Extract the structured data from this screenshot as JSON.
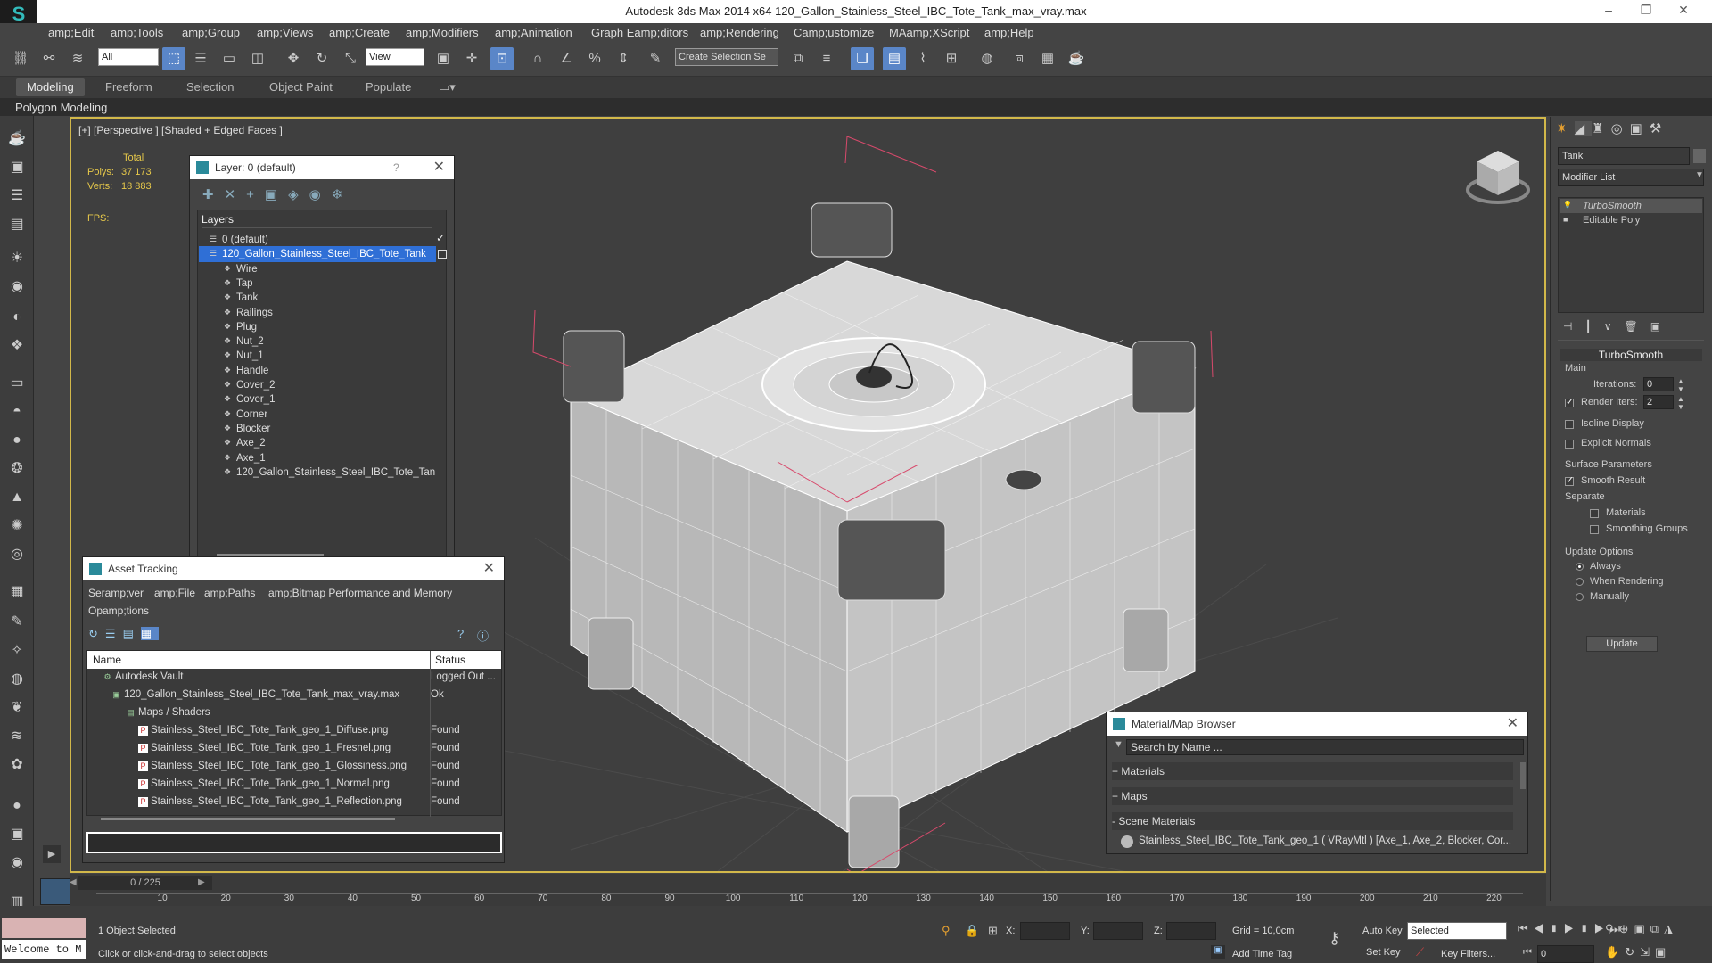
{
  "app": {
    "title": "Autodesk 3ds Max  2014 x64     120_Gallon_Stainless_Steel_IBC_Tote_Tank_max_vray.max"
  },
  "menu": [
    "amp;Edit",
    "amp;Tools",
    "amp;Group",
    "amp;Views",
    "amp;Create",
    "amp;Modifiers",
    "amp;Animation",
    "Graph Eamp;ditors",
    "amp;Rendering",
    "Camp;ustomize",
    "MAamp;XScript",
    "amp;Help"
  ],
  "toolbar": {
    "filter": "All",
    "coord": "View",
    "selset": "Create Selection Se"
  },
  "ribbon": {
    "tabs": [
      "Modeling",
      "Freeform",
      "Selection",
      "Object Paint",
      "Populate"
    ],
    "sub": "Polygon Modeling"
  },
  "viewport": {
    "label": "[+] [Perspective ] [Shaded + Edged Faces ]",
    "stats": {
      "total": "Total",
      "polys_label": "Polys:",
      "polys": "37 173",
      "verts_label": "Verts:",
      "verts": "18 883",
      "fps": "FPS:"
    }
  },
  "layer_win": {
    "title": "Layer: 0 (default)",
    "help": "?",
    "col": "Layers",
    "items": [
      "0 (default)",
      "120_Gallon_Stainless_Steel_IBC_Tote_Tank",
      "Wire",
      "Tap",
      "Tank",
      "Railings",
      "Plug",
      "Nut_2",
      "Nut_1",
      "Handle",
      "Cover_2",
      "Cover_1",
      "Corner",
      "Blocker",
      "Axe_2",
      "Axe_1",
      "120_Gallon_Stainless_Steel_IBC_Tote_Tan"
    ]
  },
  "asset_win": {
    "title": "Asset Tracking",
    "menu": [
      "Seramp;ver",
      "amp;File",
      "amp;Paths",
      "amp;Bitmap Performance and Memory"
    ],
    "menu2": "Opamp;tions",
    "cols": [
      "Name",
      "Status"
    ],
    "rows": [
      {
        "name": "Autodesk Vault",
        "status": "Logged Out ..."
      },
      {
        "name": "120_Gallon_Stainless_Steel_IBC_Tote_Tank_max_vray.max",
        "status": "Ok"
      },
      {
        "name": "Maps / Shaders",
        "status": ""
      },
      {
        "name": "Stainless_Steel_IBC_Tote_Tank_geo_1_Diffuse.png",
        "status": "Found"
      },
      {
        "name": "Stainless_Steel_IBC_Tote_Tank_geo_1_Fresnel.png",
        "status": "Found"
      },
      {
        "name": "Stainless_Steel_IBC_Tote_Tank_geo_1_Glossiness.png",
        "status": "Found"
      },
      {
        "name": "Stainless_Steel_IBC_Tote_Tank_geo_1_Normal.png",
        "status": "Found"
      },
      {
        "name": "Stainless_Steel_IBC_Tote_Tank_geo_1_Reflection.png",
        "status": "Found"
      }
    ]
  },
  "mat_win": {
    "title": "Material/Map Browser",
    "search": "Search by Name ...",
    "sections": [
      "+ Materials",
      "+ Maps",
      "- Scene Materials"
    ],
    "item": "Stainless_Steel_IBC_Tote_Tank_geo_1 ( VRayMtl ) [Axe_1, Axe_2, Blocker, Cor..."
  },
  "panel": {
    "name": "Tank",
    "modlist": "Modifier List",
    "stack": [
      "TurboSmooth",
      "Editable Poly"
    ],
    "rollout": "TurboSmooth",
    "main": "Main",
    "iter_label": "Iterations:",
    "iter": "0",
    "render_label": "Render Iters:",
    "render": "2",
    "isoline": "Isoline Display",
    "explicit": "Explicit Normals",
    "surface": "Surface Parameters",
    "smooth": "Smooth Result",
    "separate": "Separate",
    "materials": "Materials",
    "smoothing": "Smoothing Groups",
    "update_opts": "Update Options",
    "always": "Always",
    "when_rendering": "When Rendering",
    "manually": "Manually",
    "update": "Update"
  },
  "timeline": {
    "frame": "0 / 225",
    "ticks": [
      "10",
      "20",
      "30",
      "40",
      "50",
      "60",
      "70",
      "80",
      "90",
      "100",
      "110",
      "120",
      "130",
      "140",
      "150",
      "160",
      "170",
      "180",
      "190",
      "200",
      "210",
      "220"
    ]
  },
  "status": {
    "welcome": "Welcome to M",
    "selected": "1 Object Selected",
    "hint": "Click or click-and-drag to select objects",
    "x": "X:",
    "y": "Y:",
    "z": "Z:",
    "grid": "Grid = 10,0cm",
    "autokey": "Auto Key",
    "setkey": "Set Key",
    "keyfilters": "Key Filters...",
    "selmode": "Selected",
    "addtime": "Add Time Tag",
    "frame": "0"
  },
  "colors": {
    "accent": "#5a86c8",
    "viewport_border": "#d2b84a",
    "stats": "#e6c84a",
    "selection": "#2f6fd6"
  }
}
